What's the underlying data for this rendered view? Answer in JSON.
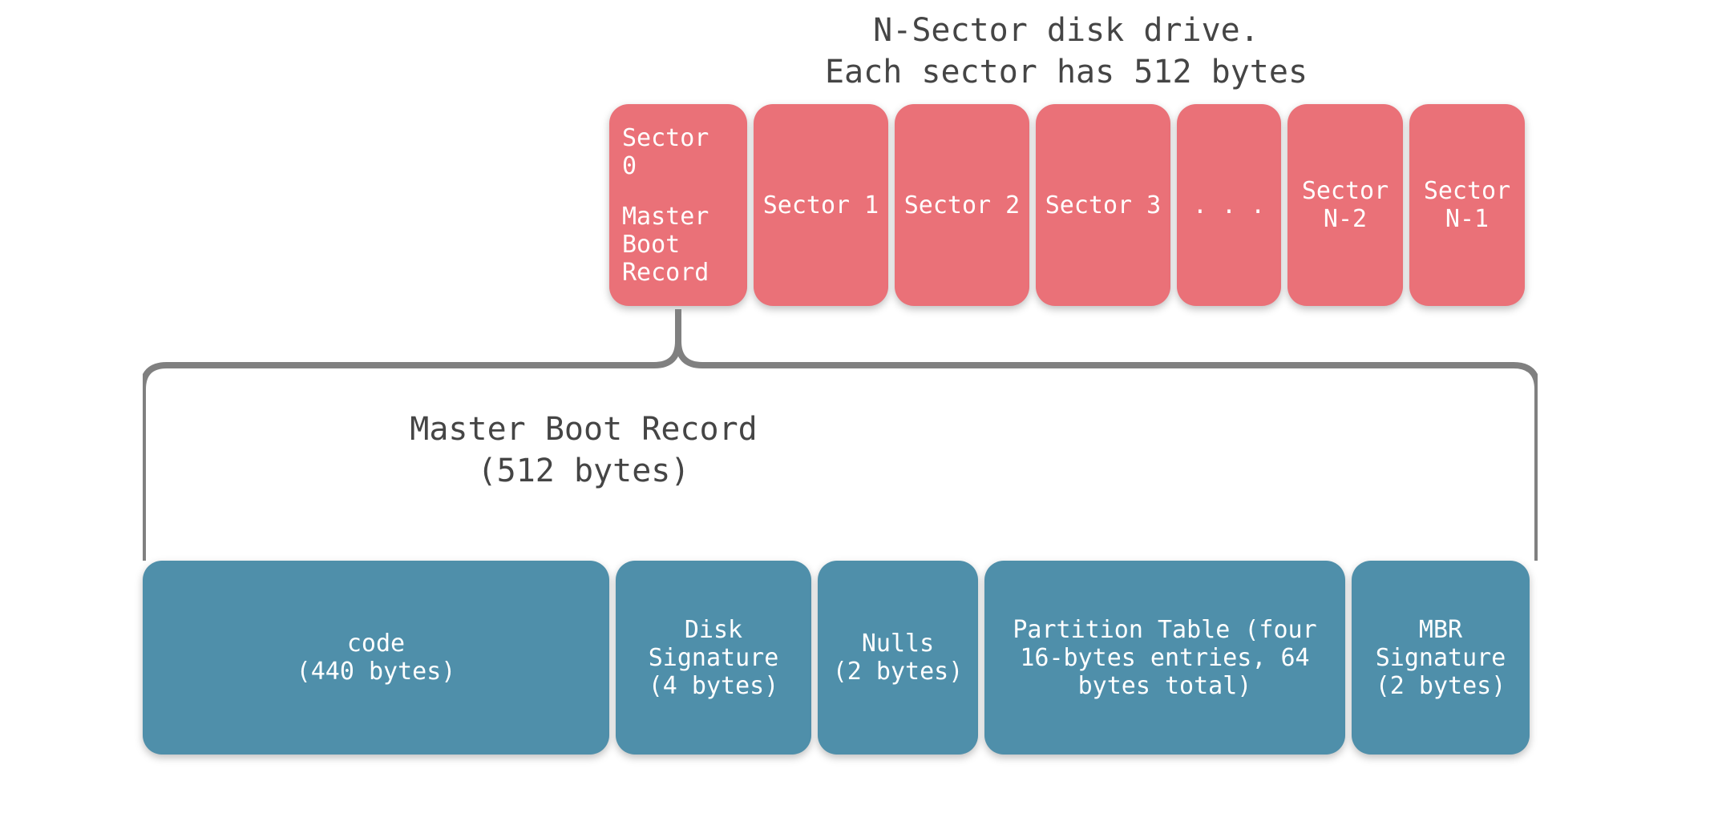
{
  "disk": {
    "title_line1": "N-Sector disk drive.",
    "title_line2": "Each sector has 512 bytes",
    "sectors": [
      {
        "top": "Sector 0",
        "label": "Master Boot Record"
      },
      {
        "top": "",
        "label": "Sector 1"
      },
      {
        "top": "",
        "label": "Sector 2"
      },
      {
        "top": "",
        "label": "Sector 3"
      },
      {
        "top": "",
        "label": ". . ."
      },
      {
        "top": "",
        "label": "Sector N-2"
      },
      {
        "top": "",
        "label": "Sector N-1"
      }
    ]
  },
  "mbr": {
    "title_line1": "Master Boot Record",
    "title_line2": "(512 bytes)",
    "parts": [
      {
        "label": "code",
        "bytes": "(440 bytes)"
      },
      {
        "label": "Disk Signature",
        "bytes": "(4 bytes)"
      },
      {
        "label": "Nulls",
        "bytes": "(2 bytes)"
      },
      {
        "label": "Partition Table (four 16-bytes entries, 64 bytes total)",
        "bytes": ""
      },
      {
        "label": "MBR Signature",
        "bytes": "(2 bytes)"
      }
    ]
  },
  "colors": {
    "sector": "#ea7178",
    "mbr": "#4f8faa",
    "bracket": "#808080"
  }
}
